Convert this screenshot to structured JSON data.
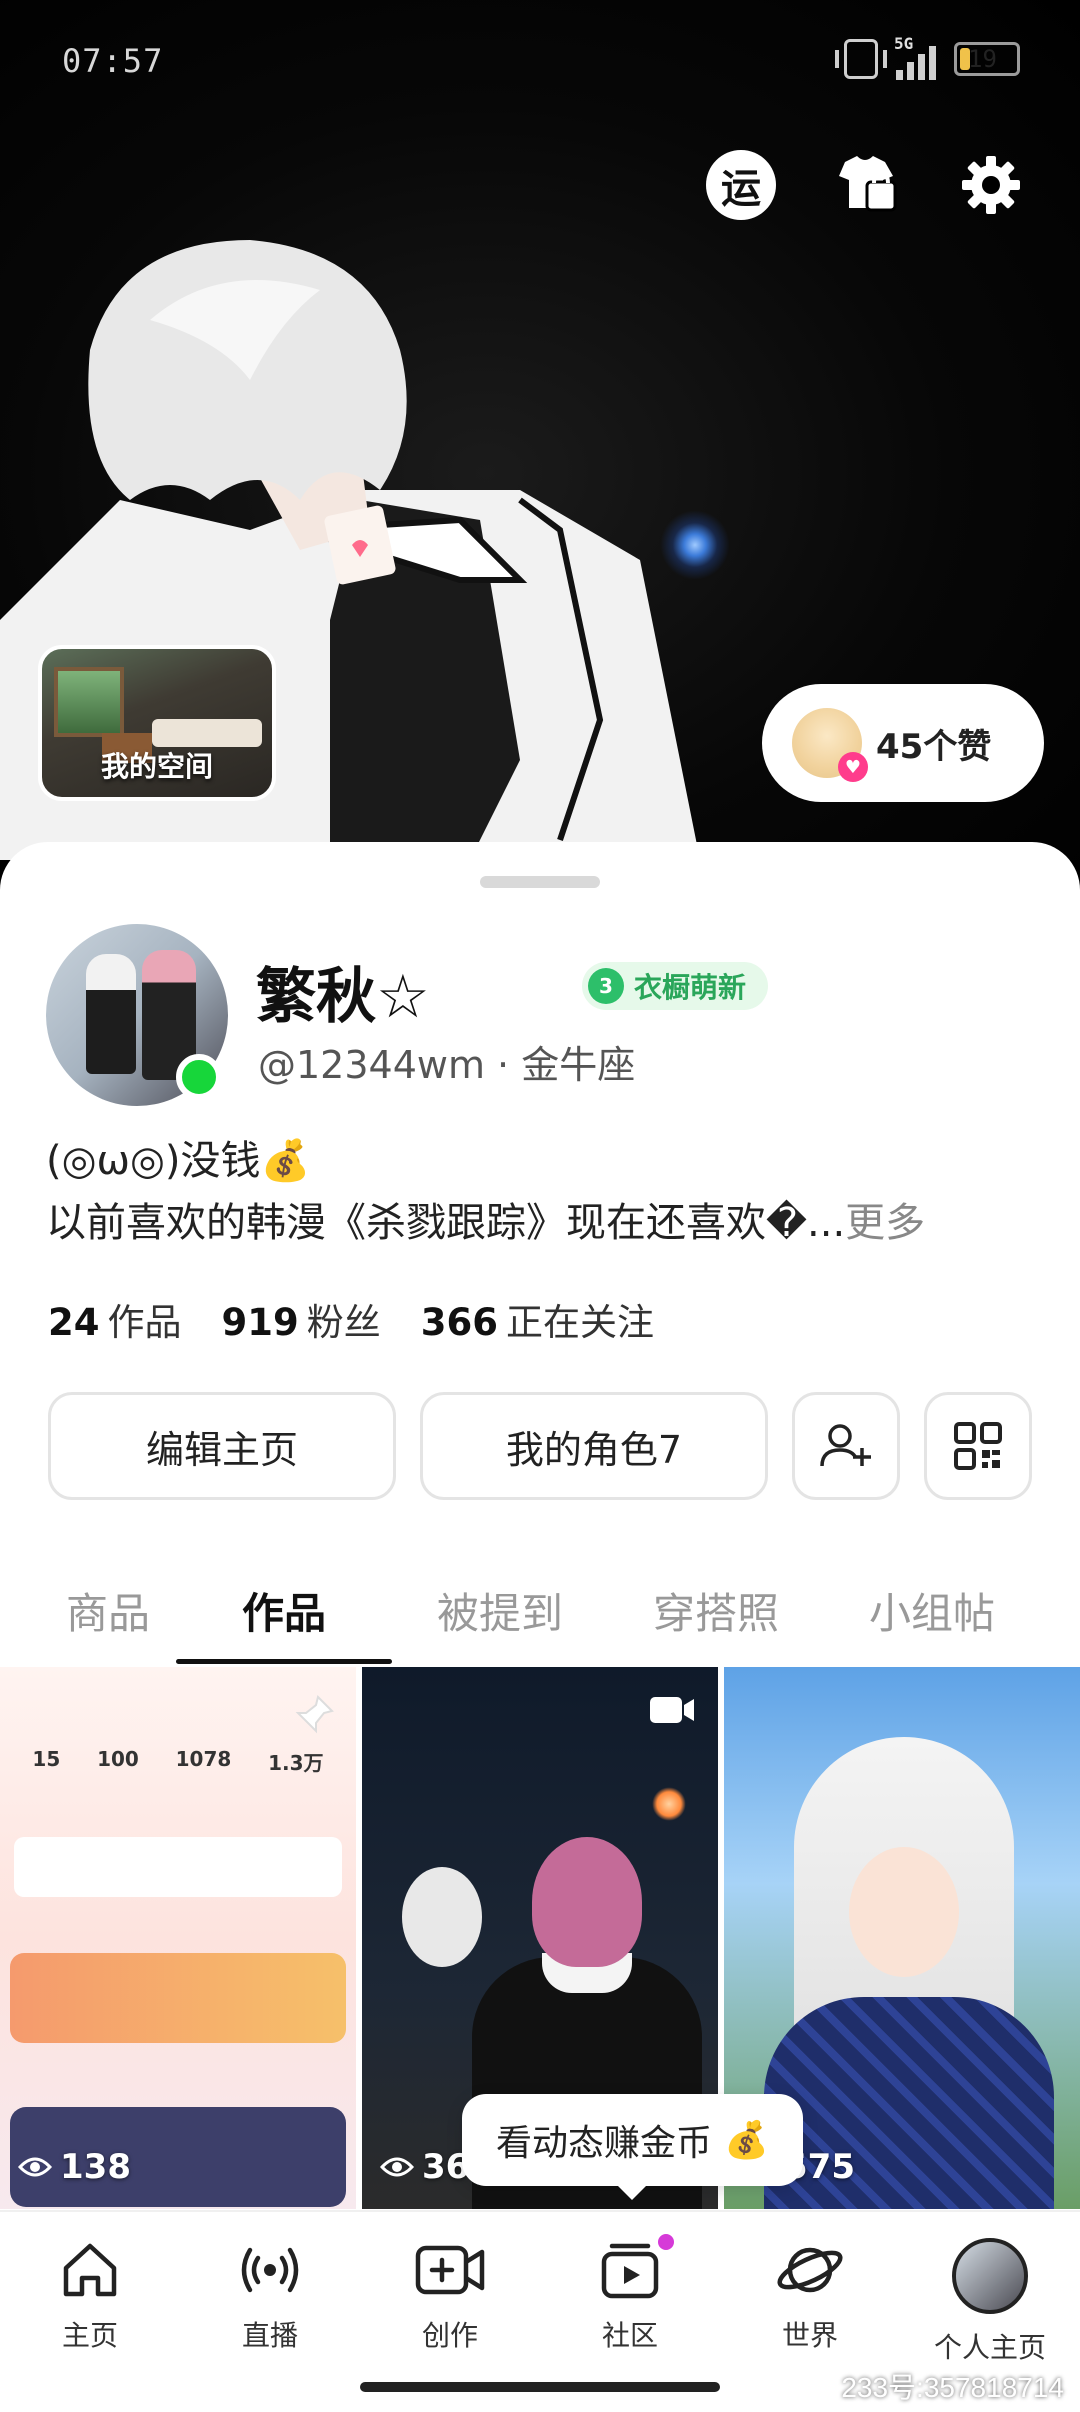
{
  "status_bar": {
    "time": "07:57",
    "network": "5G",
    "battery": "19",
    "battery_level": 0.19
  },
  "hero": {
    "fortune_label": "运",
    "my_space_label": "我的空间",
    "likes_label": "45个赞"
  },
  "profile": {
    "name": "繁秋☆",
    "wardrobe_level": "3",
    "wardrobe_badge": "衣橱萌新",
    "handle": "@12344wm · 金牛座",
    "bio_line1": "(◎ω◎)没钱💰",
    "bio_line2": "以前喜欢的韩漫《杀戮跟踪》现在还喜欢�...",
    "bio_more": "更多"
  },
  "stats": [
    {
      "value": "24",
      "label": "作品"
    },
    {
      "value": "919",
      "label": "粉丝"
    },
    {
      "value": "366",
      "label": "正在关注"
    }
  ],
  "actions": {
    "edit_profile": "编辑主页",
    "my_character": "我的角色7"
  },
  "tabs": [
    {
      "label": "商品",
      "active": false
    },
    {
      "label": "作品",
      "active": true
    },
    {
      "label": "被提到",
      "active": false
    },
    {
      "label": "穿搭照",
      "active": false
    },
    {
      "label": "小组帖",
      "active": false
    }
  ],
  "posts": [
    {
      "views": "138"
    },
    {
      "views": "36"
    },
    {
      "views": "575"
    }
  ],
  "post1_mini": {
    "stats": [
      "15",
      "100",
      "1078",
      "1.3万"
    ]
  },
  "toast": {
    "text": "看动态赚金币",
    "icon": "💰"
  },
  "nav": [
    {
      "label": "主页",
      "icon": "home-icon"
    },
    {
      "label": "直播",
      "icon": "live-icon"
    },
    {
      "label": "创作",
      "icon": "create-icon"
    },
    {
      "label": "社区",
      "icon": "community-icon"
    },
    {
      "label": "世界",
      "icon": "world-icon"
    },
    {
      "label": "个人主页",
      "icon": "profile-icon"
    }
  ],
  "watermark": "233号:357818714",
  "colors": {
    "online": "#17d63a",
    "badge_green": "#2aa65a",
    "notification_dot": "#d63ad8"
  }
}
